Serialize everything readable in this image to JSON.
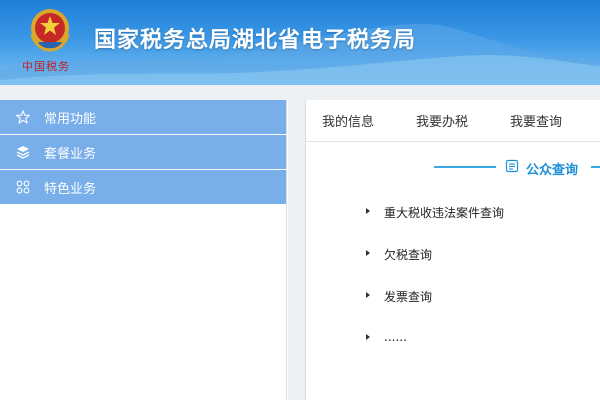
{
  "header": {
    "title": "国家税务总局湖北省电子税务局",
    "emblem_caption": "中国税务",
    "emblem_icon": "tax-emblem-icon"
  },
  "sidebar": {
    "items": [
      {
        "label": "常用功能",
        "icon": "star-icon"
      },
      {
        "label": "套餐业务",
        "icon": "layers-icon"
      },
      {
        "label": "特色业务",
        "icon": "grid-icon"
      }
    ]
  },
  "main": {
    "tabs": [
      {
        "label": "我的信息"
      },
      {
        "label": "我要办税"
      },
      {
        "label": "我要查询"
      }
    ],
    "section": {
      "title": "公众查询",
      "icon": "document-icon",
      "accent": "#39a9e0"
    },
    "links": [
      {
        "label": "重大税收违法案件查询"
      },
      {
        "label": "欠税查询"
      },
      {
        "label": "发票查询"
      },
      {
        "label": "......"
      }
    ]
  },
  "colors": {
    "banner": "#2a88dd",
    "sidebar_item": "#78aeea",
    "section_title": "#1f8fd8"
  }
}
